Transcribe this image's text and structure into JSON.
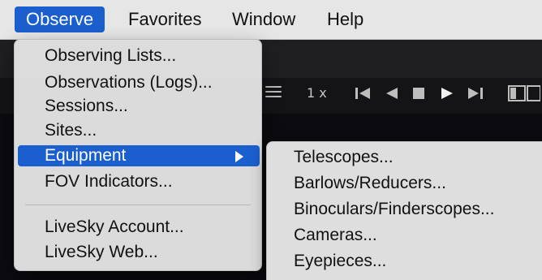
{
  "menubar": {
    "items": [
      {
        "label": "Observe",
        "active": true
      },
      {
        "label": "Favorites",
        "active": false
      },
      {
        "label": "Window",
        "active": false
      },
      {
        "label": "Help",
        "active": false
      }
    ]
  },
  "toolbar": {
    "speed_label": "1 x",
    "icons": [
      "menu-icon",
      "skip-to-start-icon",
      "step-back-icon",
      "stop-icon",
      "play-icon",
      "skip-to-end-icon",
      "panels-icon"
    ]
  },
  "observe_menu": {
    "items": [
      {
        "label": "Observing Lists...",
        "selected": false,
        "has_submenu": false
      },
      {
        "label": "Observations (Logs)...",
        "selected": false,
        "has_submenu": false
      },
      {
        "label": "Sessions...",
        "selected": false,
        "has_submenu": false
      },
      {
        "label": "Sites...",
        "selected": false,
        "has_submenu": false
      },
      {
        "label": "Equipment",
        "selected": true,
        "has_submenu": true
      },
      {
        "label": "FOV Indicators...",
        "selected": false,
        "has_submenu": false
      },
      {
        "label": "LiveSky Account...",
        "selected": false,
        "has_submenu": false
      },
      {
        "label": "LiveSky Web...",
        "selected": false,
        "has_submenu": false
      }
    ]
  },
  "equipment_submenu": {
    "items": [
      {
        "label": "Telescopes..."
      },
      {
        "label": "Barlows/Reducers..."
      },
      {
        "label": "Binoculars/Finderscopes..."
      },
      {
        "label": "Cameras..."
      },
      {
        "label": "Eyepieces..."
      }
    ]
  },
  "colors": {
    "menu_highlight": "#1b5fcf",
    "menu_background": "#e2e2e2",
    "app_background": "#0b0b10"
  }
}
